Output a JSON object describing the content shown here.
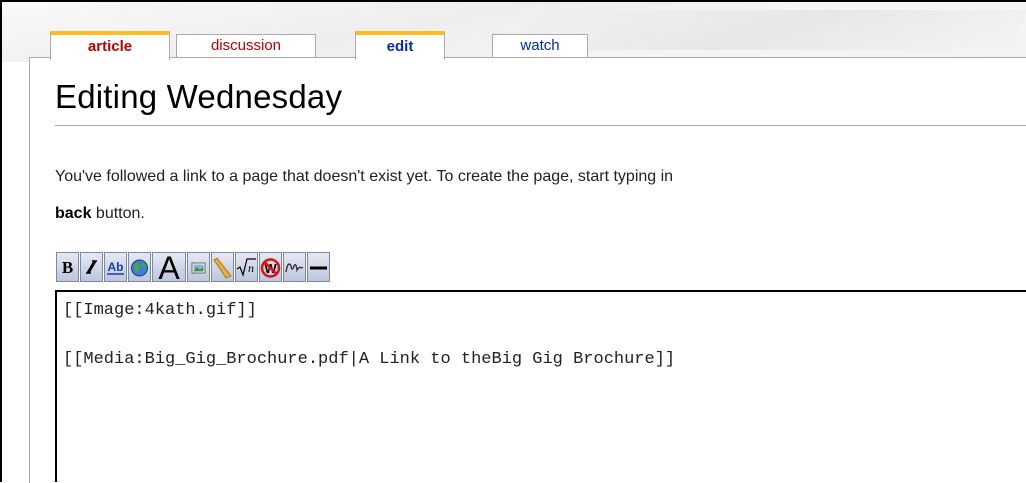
{
  "tabs": [
    {
      "label": "article"
    },
    {
      "label": "discussion"
    },
    {
      "label": "edit"
    },
    {
      "label": "watch"
    }
  ],
  "page_title": "Editing Wednesday",
  "intro": {
    "line1": "You've followed a link to a page that doesn't exist yet. To create the page, start typing in",
    "line2_bold": "back",
    "line2_rest": " button."
  },
  "toolbar": {
    "buttons": [
      {
        "icon": "bold-icon"
      },
      {
        "icon": "italic-icon"
      },
      {
        "icon": "internal-link-icon"
      },
      {
        "icon": "external-link-icon"
      },
      {
        "icon": "headline-icon"
      },
      {
        "icon": "embedded-image-icon"
      },
      {
        "icon": "media-file-icon"
      },
      {
        "icon": "math-formula-icon"
      },
      {
        "icon": "nowiki-icon"
      },
      {
        "icon": "signature-icon"
      },
      {
        "icon": "horizontal-line-icon"
      }
    ]
  },
  "editor": {
    "lines": [
      "[[Image:4kath.gif]]",
      "",
      "[[Media:Big_Gig_Brochure.pdf|A Link to theBig Gig Brochure]]"
    ]
  },
  "colors": {
    "selected_tab_accent": "#fabd23",
    "new_link_red": "#ba0000",
    "link_blue": "#002bb8"
  }
}
